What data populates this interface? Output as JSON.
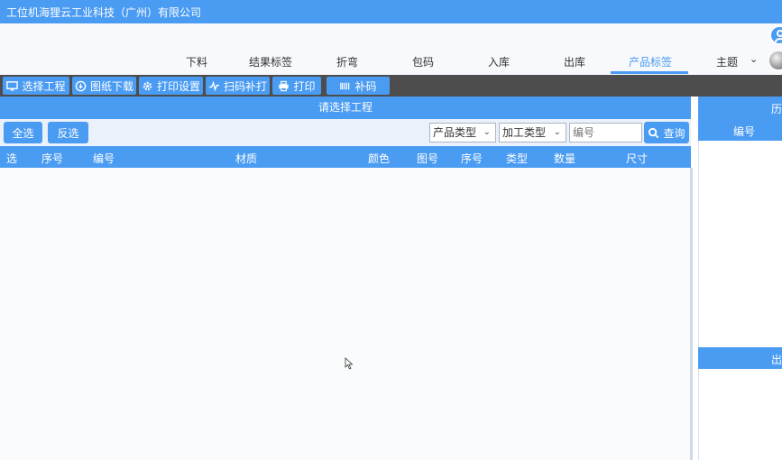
{
  "window": {
    "title": "工位机海狸云工业科技（广州）有限公司"
  },
  "nav": {
    "tabs": [
      {
        "label": "下料"
      },
      {
        "label": "结果标签"
      },
      {
        "label": "折弯"
      },
      {
        "label": "包码"
      },
      {
        "label": "入库"
      },
      {
        "label": "出库"
      },
      {
        "label": "产品标签",
        "active": true
      }
    ],
    "theme_label": "主题"
  },
  "toolbar": {
    "select_project": "选择工程",
    "drawing_download": "图纸下载",
    "print_settings": "打印设置",
    "scan_reprint": "扫码补打",
    "print": "打印",
    "reprint_code": "补码"
  },
  "panel": {
    "title": "请选择工程",
    "select_all": "全选",
    "invert_select": "反选",
    "product_type": "产品类型",
    "process_type": "加工类型",
    "code_placeholder": "编号",
    "query": "查询"
  },
  "table": {
    "columns": [
      "选",
      "序号",
      "编号",
      "材质",
      "颜色",
      "图号",
      "序号",
      "类型",
      "数量",
      "尺寸"
    ]
  },
  "right_panel": {
    "header": "历",
    "column": "编号",
    "footer": "出"
  },
  "colors": {
    "accent": "#4a9bf2",
    "toolbar_bg": "#4d4d4d"
  }
}
